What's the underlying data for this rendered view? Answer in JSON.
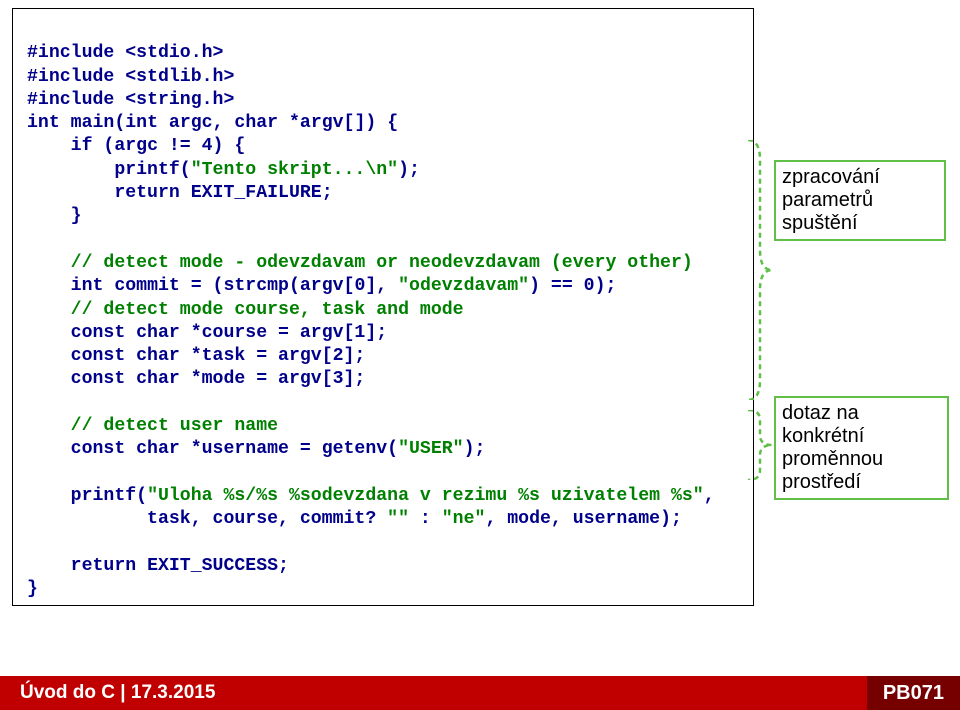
{
  "code": {
    "l1a": "#include ",
    "l1b": "<stdio.h>",
    "l2a": "#include ",
    "l2b": "<stdlib.h>",
    "l3a": "#include ",
    "l3b": "<string.h>",
    "l4a": "int ",
    "l4b": "main(int ",
    "l4c": "argc, ",
    "l4d": "char ",
    "l4e": "*argv[]) {",
    "l5a": "    if ",
    "l5b": "(argc != 4) {",
    "l6a": "        printf(",
    "l6b": "\"Tento skript...\\n\"",
    "l6c": ");",
    "l7a": "        return ",
    "l7b": "EXIT_FAILURE;",
    "l8": "    }",
    "blank1": "",
    "l9": "    // detect mode - odevzdavam or neodevzdavam (every other)",
    "l10a": "    int ",
    "l10b": "commit = (strcmp(argv[0], ",
    "l10c": "\"odevzdavam\"",
    "l10d": ") == 0);",
    "l11": "    // detect mode course, task and mode",
    "l12a": "    const char ",
    "l12b": "*course = argv[1];",
    "l13a": "    const char ",
    "l13b": "*task = argv[2];",
    "l14a": "    const char ",
    "l14b": "*mode = argv[3];",
    "blank2": "",
    "l15": "    // detect user name",
    "l16a": "    const char ",
    "l16b": "*username = getenv(",
    "l16c": "\"USER\"",
    "l16d": ");",
    "blank3": "",
    "l17a": "    printf(",
    "l17b": "\"Uloha %s/%s %sodevzdana v rezimu %s uzivatelem %s\"",
    "l17c": ",",
    "l18a": "           task, course, commit? ",
    "l18b": "\"\"",
    "l18c": " : ",
    "l18d": "\"ne\"",
    "l18e": ", mode, username);",
    "blank4": "",
    "l19a": "    return ",
    "l19b": "EXIT_SUCCESS;",
    "l20": "}"
  },
  "annot1": {
    "line1": "zpracování",
    "line2": "parametrů",
    "line3": "spuštění"
  },
  "annot2": {
    "line1": "dotaz na",
    "line2": "konkrétní",
    "line3": "proměnnou",
    "line4": "prostředí"
  },
  "footer": {
    "left_title": "Úvod do C",
    "sep": " | ",
    "date": "17.3.2015",
    "right": "PB071"
  }
}
